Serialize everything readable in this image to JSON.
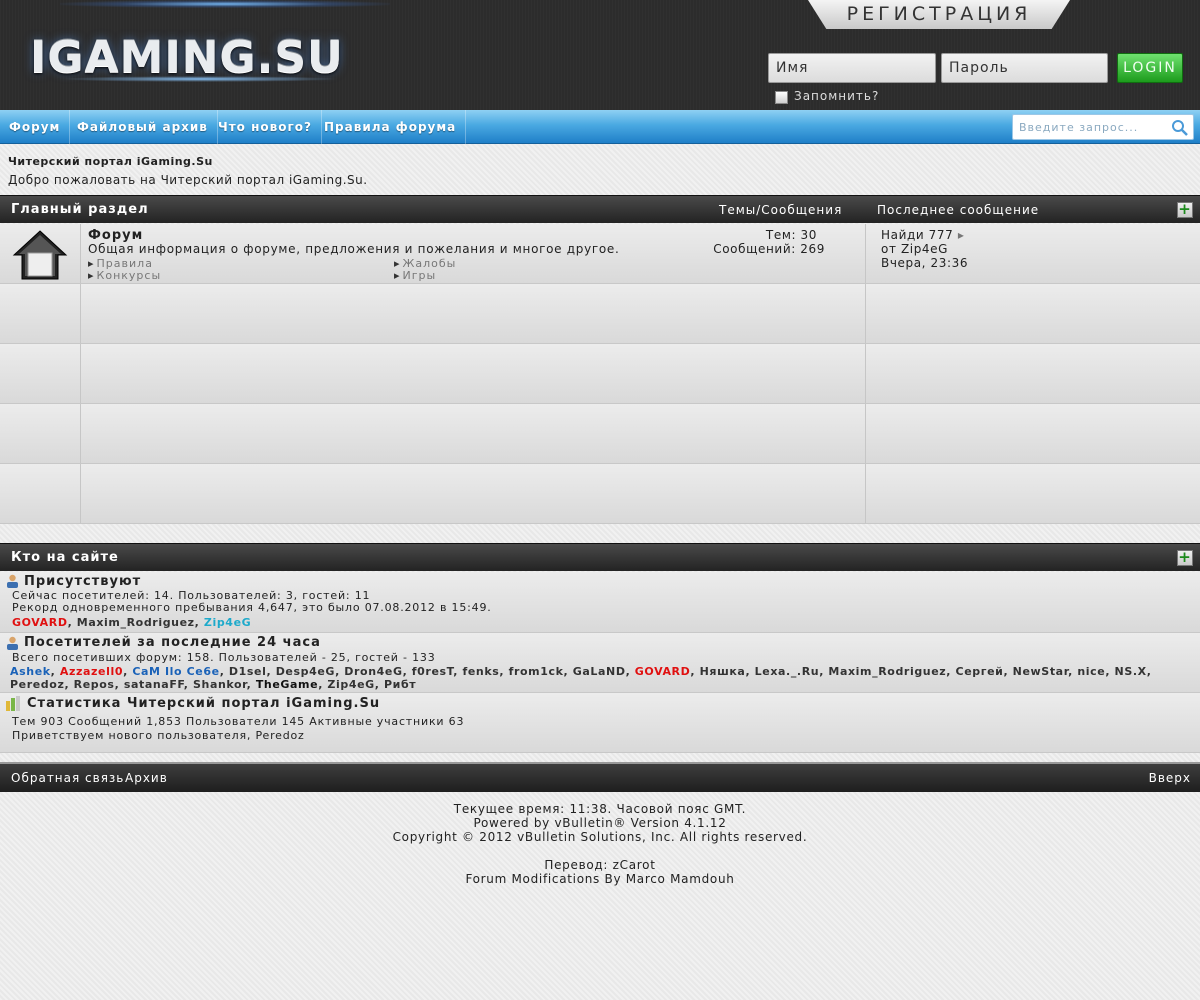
{
  "header": {
    "logo": "IGAMING.SU",
    "register": "РЕГИСТРАЦИЯ",
    "username_placeholder": "Имя",
    "password_placeholder": "Пароль",
    "login": "LOGIN",
    "remember": "Запомнить?"
  },
  "nav": {
    "items": [
      "Форум",
      "Файловый архив",
      "Что нового?",
      "Правила форума"
    ],
    "search_placeholder": "Введите запрос..."
  },
  "intro": {
    "title": "Читерский портал iGaming.Su",
    "welcome": "Добро пожаловать на Читерский портал iGaming.Su."
  },
  "main_section": {
    "title": "Главный раздел",
    "col_threads": "Темы/Сообщения",
    "col_last": "Последнее сообщение",
    "forum": {
      "name": "Форум",
      "description": "Общая информация о форуме, предложения и пожелания и многое другое.",
      "subforums": [
        "Правила",
        "Жалобы",
        "Конкурсы",
        "Игры"
      ],
      "threads": "Тем: 30",
      "posts": "Сообщений: 269",
      "last_title": "Найди 777",
      "last_by": "от Zip4eG",
      "last_time": "Вчера, 23:36"
    }
  },
  "whos_online": {
    "title": "Кто на сайте",
    "present_heading": "Присутствуют",
    "present_line1": "Сейчас посетителей: 14. Пользователей: 3, гостей: 11",
    "present_line2": "Рекорд одновременного пребывания 4,647, это было 07.08.2012 в 15:49.",
    "present_users": [
      {
        "name": "GOVARD",
        "color": "#e01010"
      },
      {
        "name": "Maxim_Rodriguez",
        "color": "#333333"
      },
      {
        "name": "Zip4eG",
        "color": "#1eaacb"
      }
    ],
    "day_heading": "Посетителей за последние 24 часа",
    "day_line": "Всего посетивших форум: 158. Пользователей - 25, гостей - 133",
    "day_users": [
      {
        "name": "Ashek",
        "color": "#1a62b8"
      },
      {
        "name": "Azzazell0",
        "color": "#e01010"
      },
      {
        "name": "CaM Ilo Ce6e",
        "color": "#1a62b8"
      },
      {
        "name": "D1sel",
        "color": "#333333"
      },
      {
        "name": "Desp4eG",
        "color": "#333333"
      },
      {
        "name": "Dron4eG",
        "color": "#333333"
      },
      {
        "name": "f0resT",
        "color": "#333333"
      },
      {
        "name": "fenks",
        "color": "#333333"
      },
      {
        "name": "from1ck",
        "color": "#333333"
      },
      {
        "name": "GaLaND",
        "color": "#333333"
      },
      {
        "name": "GOVARD",
        "color": "#e01010"
      },
      {
        "name": "Няшка",
        "color": "#333333"
      },
      {
        "name": "Lexa._.Ru",
        "color": "#333333"
      },
      {
        "name": "Maxim_Rodriguez",
        "color": "#333333"
      },
      {
        "name": "Сергей",
        "color": "#333333"
      },
      {
        "name": "NewStar",
        "color": "#333333"
      },
      {
        "name": "nice",
        "color": "#333333"
      },
      {
        "name": "NS.X",
        "color": "#333333"
      },
      {
        "name": "Peredoz",
        "color": "#333333"
      },
      {
        "name": "Repos",
        "color": "#333333"
      },
      {
        "name": "satanaFF",
        "color": "#333333"
      },
      {
        "name": "Shankor",
        "color": "#333333"
      },
      {
        "name": "TheGame",
        "color": "#111111"
      },
      {
        "name": "Zip4eG",
        "color": "#333333"
      },
      {
        "name": "Рибт",
        "color": "#333333"
      }
    ],
    "stats_heading": "Статистика Читерский портал iGaming.Su",
    "stats_line1": "Тем 903 Сообщений 1,853 Пользователи 145 Активные участники 63",
    "stats_line2": "Приветствуем нового пользователя, Peredoz"
  },
  "footer": {
    "feedback": "Обратная связь",
    "archive": "Архив",
    "top": "Вверх",
    "lines": [
      "Текущее время: 11:38. Часовой пояс GMT.",
      "Powered by vBulletin® Version 4.1.12",
      "Copyright © 2012 vBulletin Solutions, Inc. All rights reserved.",
      "",
      "Перевод: zCarot",
      "Forum Modifications By Marco Mamdouh"
    ]
  }
}
